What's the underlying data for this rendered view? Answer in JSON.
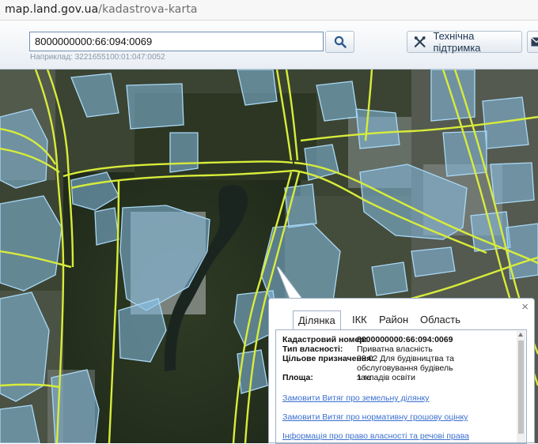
{
  "browser": {
    "url_host": "map.land.gov.ua",
    "url_path": "/kadastrova-karta"
  },
  "search": {
    "value": "8000000000:66:094:0069",
    "example": "Наприклад: 3221655100:01:047:0052"
  },
  "toolbar": {
    "support_label": "Технічна підтримка"
  },
  "popup": {
    "close": "×",
    "tabs": [
      "Ділянка",
      "ІКК",
      "Район",
      "Область"
    ],
    "active_tab": "Ділянка",
    "fields": [
      {
        "label": "Кадастровий номер:",
        "value": "8000000000:66:094:0069"
      },
      {
        "label": "Тип власності:",
        "value": "Приватна власність"
      },
      {
        "label": "Цільове призначення:",
        "value": "03.02 Для будівництва та обслуговування будівель закладів освіти"
      },
      {
        "label": "Площа:",
        "value": "1 га"
      }
    ],
    "links": [
      "Замовити Витяг про земельну ділянку",
      "Замовити Витяг про нормативну грошову оцінку",
      "Інформація про право власності та речові права"
    ]
  },
  "colors": {
    "parcel_fill": "#86bfe6",
    "parcel_stroke": "#a9d8f5",
    "road": "#d8ec3a",
    "link": "#3a6fcf"
  }
}
